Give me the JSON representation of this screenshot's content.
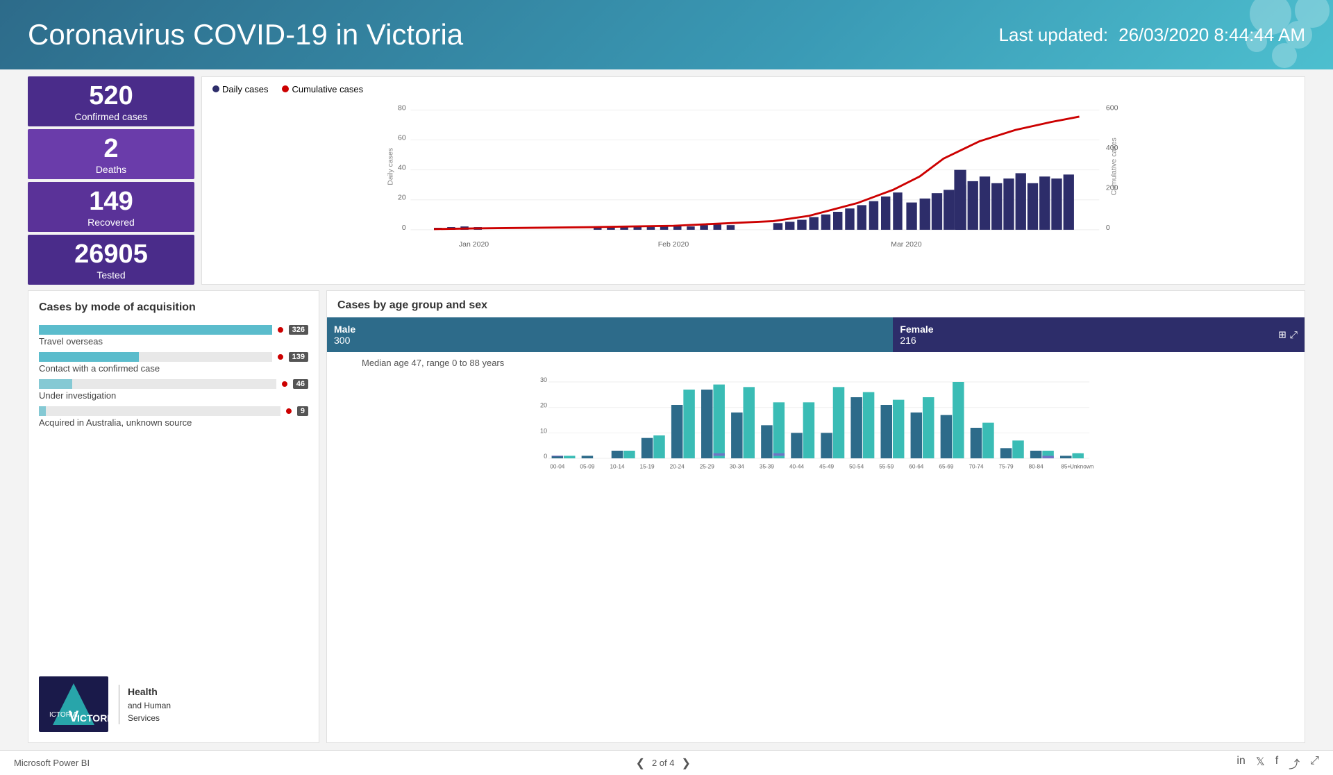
{
  "header": {
    "title": "Coronavirus COVID-19 in Victoria",
    "updated_label": "Last updated:",
    "updated_value": "26/03/2020 8:44:44 AM"
  },
  "stats": {
    "confirmed": {
      "value": "520",
      "label": "Confirmed cases"
    },
    "deaths": {
      "value": "2",
      "label": "Deaths"
    },
    "recovered": {
      "value": "149",
      "label": "Recovered"
    },
    "tested": {
      "value": "26905",
      "label": "Tested"
    }
  },
  "chart": {
    "legend_daily": "Daily cases",
    "legend_cumulative": "Cumulative cases",
    "y_left_label": "Daily cases",
    "y_right_label": "Cumulative cases",
    "x_labels": [
      "Jan 2020",
      "Feb 2020",
      "Mar 2020"
    ],
    "y_left_max": 80,
    "y_right_max": 600
  },
  "acquisition": {
    "title": "Cases by mode of acquisition",
    "items": [
      {
        "label": "Travel overseas",
        "value": "326",
        "pct": 100
      },
      {
        "label": "Contact with a confirmed case",
        "value": "139",
        "pct": 43
      },
      {
        "label": "Under investigation",
        "value": "46",
        "pct": 14
      },
      {
        "label": "Acquired in Australia, unknown source",
        "value": "9",
        "pct": 3
      }
    ]
  },
  "age_sex": {
    "title": "Cases by age group and sex",
    "male_label": "Male",
    "male_count": "300",
    "female_label": "Female",
    "female_count": "216",
    "median_text": "Median age 47, range 0 to 88 years",
    "age_groups": [
      "00-04",
      "05-09",
      "10-14",
      "15-19",
      "20-24",
      "25-29",
      "30-34",
      "35-39",
      "40-44",
      "45-49",
      "50-54",
      "55-59",
      "60-64",
      "65-69",
      "70-74",
      "75-79",
      "80-84",
      "85+",
      "Unknown"
    ],
    "male_vals": [
      1,
      1,
      2,
      8,
      21,
      27,
      18,
      13,
      10,
      10,
      24,
      21,
      18,
      17,
      12,
      4,
      5,
      1,
      3
    ],
    "female_vals": [
      1,
      0,
      2,
      9,
      27,
      29,
      28,
      21,
      22,
      28,
      26,
      23,
      24,
      30,
      14,
      7,
      3,
      2,
      2
    ],
    "purple_male": [
      0,
      0,
      0,
      0,
      0,
      2,
      0,
      0,
      0,
      0,
      0,
      0,
      0,
      0,
      0,
      0,
      0,
      0,
      0
    ],
    "purple_female": [
      0,
      0,
      0,
      1,
      0,
      0,
      0,
      1,
      0,
      0,
      0,
      0,
      0,
      0,
      0,
      0,
      1,
      0,
      0
    ]
  },
  "footer": {
    "brand": "Microsoft Power BI",
    "page_info": "2 of 4",
    "icons": [
      "linkedin",
      "twitter",
      "facebook",
      "share",
      "fullscreen"
    ]
  }
}
